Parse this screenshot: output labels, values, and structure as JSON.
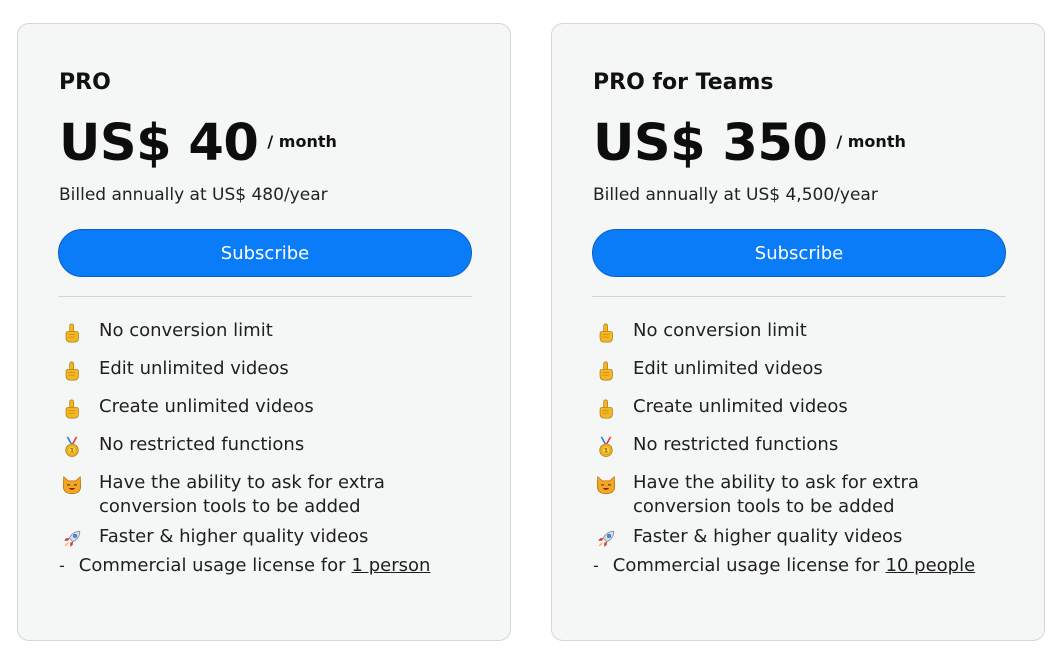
{
  "plans": [
    {
      "name": "PRO",
      "price": "US$ 40",
      "per": "/ month",
      "billed": "Billed annually at US$ 480/year",
      "subscribe_label": "Subscribe",
      "features": [
        {
          "icon": "pointing-finger-icon",
          "text": "No conversion limit"
        },
        {
          "icon": "pointing-finger-icon",
          "text": "Edit unlimited videos"
        },
        {
          "icon": "pointing-finger-icon",
          "text": "Create unlimited videos"
        },
        {
          "icon": "medal-icon",
          "text": "No restricted functions"
        },
        {
          "icon": "cat-face-icon",
          "text_line1": "Have the ability to ask for extra",
          "text_line2": "conversion tools to be added"
        },
        {
          "icon": "rocket-icon",
          "text": "Faster & higher quality videos"
        }
      ],
      "license_prefix": "Commercial usage license for",
      "license_link": "1 person"
    },
    {
      "name": "PRO for Teams",
      "price": "US$ 350",
      "per": "/ month",
      "billed": "Billed annually at US$ 4,500/year",
      "subscribe_label": "Subscribe",
      "features": [
        {
          "icon": "pointing-finger-icon",
          "text": "No conversion limit"
        },
        {
          "icon": "pointing-finger-icon",
          "text": "Edit unlimited videos"
        },
        {
          "icon": "pointing-finger-icon",
          "text": "Create unlimited videos"
        },
        {
          "icon": "medal-icon",
          "text": "No restricted functions"
        },
        {
          "icon": "cat-face-icon",
          "text_line1": "Have the ability to ask for extra",
          "text_line2": "conversion tools to be added"
        },
        {
          "icon": "rocket-icon",
          "text": "Faster & higher quality videos"
        }
      ],
      "license_prefix": "Commercial usage license for",
      "license_link": "10 people"
    }
  ],
  "colors": {
    "accent": "#0a7cf8",
    "card_bg": "#f5f6f6",
    "card_border": "#d4d6d8"
  }
}
